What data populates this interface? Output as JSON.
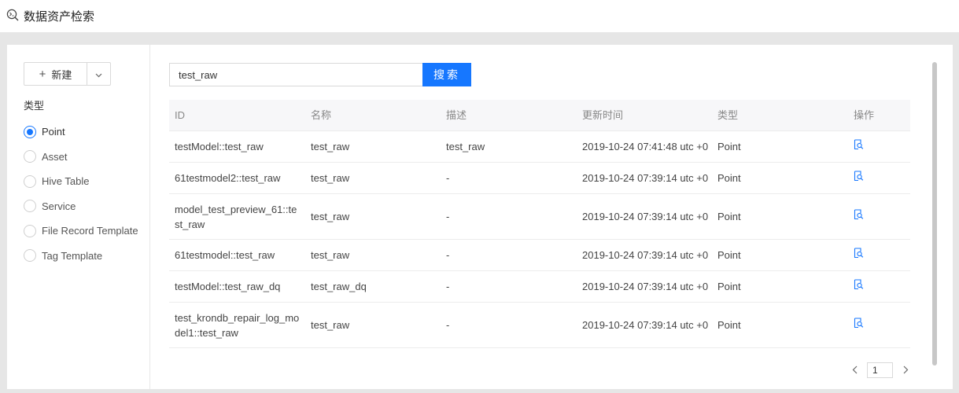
{
  "app": {
    "title": "数据资产检索",
    "icon": "asset-search-icon"
  },
  "sidebar": {
    "new_button_label": "新建",
    "type_label": "类型",
    "types": [
      {
        "label": "Point",
        "selected": true
      },
      {
        "label": "Asset",
        "selected": false
      },
      {
        "label": "Hive Table",
        "selected": false
      },
      {
        "label": "Service",
        "selected": false
      },
      {
        "label": "File Record Template",
        "selected": false
      },
      {
        "label": "Tag Template",
        "selected": false
      }
    ]
  },
  "search": {
    "value": "test_raw",
    "button_label": "搜索"
  },
  "table": {
    "headers": [
      "ID",
      "名称",
      "描述",
      "更新时间",
      "类型",
      "操作"
    ],
    "rows": [
      {
        "id": "testModel::test_raw",
        "name": "test_raw",
        "desc": "test_raw",
        "updated": "2019-10-24 07:41:48 utc +0",
        "type": "Point"
      },
      {
        "id": "61testmodel2::test_raw",
        "name": "test_raw",
        "desc": "-",
        "updated": "2019-10-24 07:39:14 utc +0",
        "type": "Point"
      },
      {
        "id": "model_test_preview_61::test_raw",
        "name": "test_raw",
        "desc": "-",
        "updated": "2019-10-24 07:39:14 utc +0",
        "type": "Point"
      },
      {
        "id": "61testmodel::test_raw",
        "name": "test_raw",
        "desc": "-",
        "updated": "2019-10-24 07:39:14 utc +0",
        "type": "Point"
      },
      {
        "id": "testModel::test_raw_dq",
        "name": "test_raw_dq",
        "desc": "-",
        "updated": "2019-10-24 07:39:14 utc +0",
        "type": "Point"
      },
      {
        "id": "test_krondb_repair_log_model1::test_raw",
        "name": "test_raw",
        "desc": "-",
        "updated": "2019-10-24 07:39:14 utc +0",
        "type": "Point"
      }
    ],
    "action_icon": "view-detail-icon"
  },
  "pagination": {
    "current_page": "1"
  },
  "colors": {
    "accent": "#1677ff",
    "band": "#e6e6e6"
  }
}
